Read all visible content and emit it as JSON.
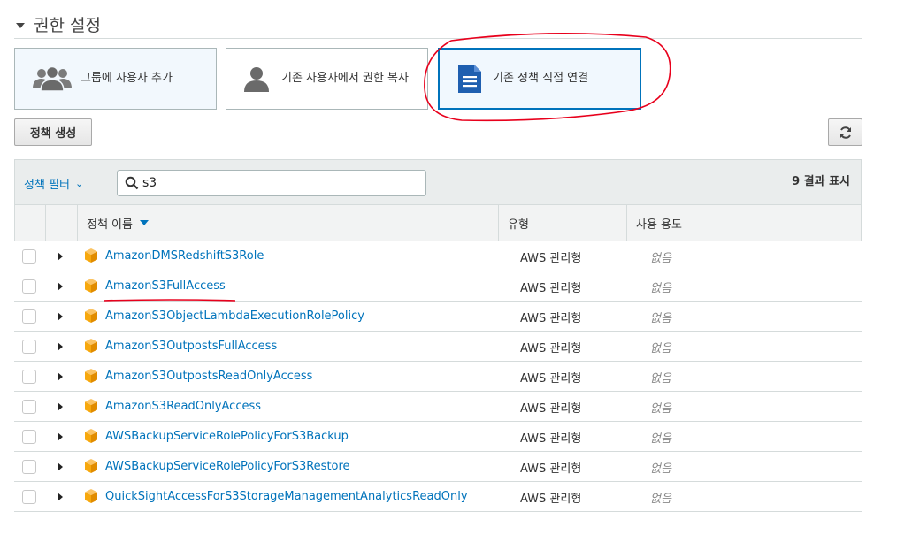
{
  "section": {
    "title": "권한 설정"
  },
  "options": [
    {
      "label": "그룹에 사용자 추가",
      "icon": "users-group-icon"
    },
    {
      "label": "기존 사용자에서 권한 복사",
      "icon": "user-icon"
    },
    {
      "label": "기존 정책 직접 연결",
      "icon": "document-icon",
      "selected": true
    }
  ],
  "toolbar": {
    "create_label": "정책 생성",
    "refresh_icon": "refresh-icon"
  },
  "filter": {
    "dropdown_label": "정책 필터",
    "search_value": "s3",
    "result_count": "9 결과 표시"
  },
  "table": {
    "headers": {
      "name": "정책 이름",
      "type": "유형",
      "usage": "사용 용도"
    },
    "rows": [
      {
        "name": "AmazonDMSRedshiftS3Role",
        "type": "AWS 관리형",
        "usage": "없음"
      },
      {
        "name": "AmazonS3FullAccess",
        "type": "AWS 관리형",
        "usage": "없음"
      },
      {
        "name": "AmazonS3ObjectLambdaExecutionRolePolicy",
        "type": "AWS 관리형",
        "usage": "없음"
      },
      {
        "name": "AmazonS3OutpostsFullAccess",
        "type": "AWS 관리형",
        "usage": "없음"
      },
      {
        "name": "AmazonS3OutpostsReadOnlyAccess",
        "type": "AWS 관리형",
        "usage": "없음"
      },
      {
        "name": "AmazonS3ReadOnlyAccess",
        "type": "AWS 관리형",
        "usage": "없음"
      },
      {
        "name": "AWSBackupServiceRolePolicyForS3Backup",
        "type": "AWS 관리형",
        "usage": "없음"
      },
      {
        "name": "AWSBackupServiceRolePolicyForS3Restore",
        "type": "AWS 관리형",
        "usage": "없음"
      },
      {
        "name": "QuickSightAccessForS3StorageManagementAnalyticsReadOnly",
        "type": "AWS 관리형",
        "usage": "없음"
      }
    ]
  },
  "colors": {
    "link": "#0073bb",
    "policy_icon": "#f7a80d",
    "annotation": "#e8001c"
  }
}
